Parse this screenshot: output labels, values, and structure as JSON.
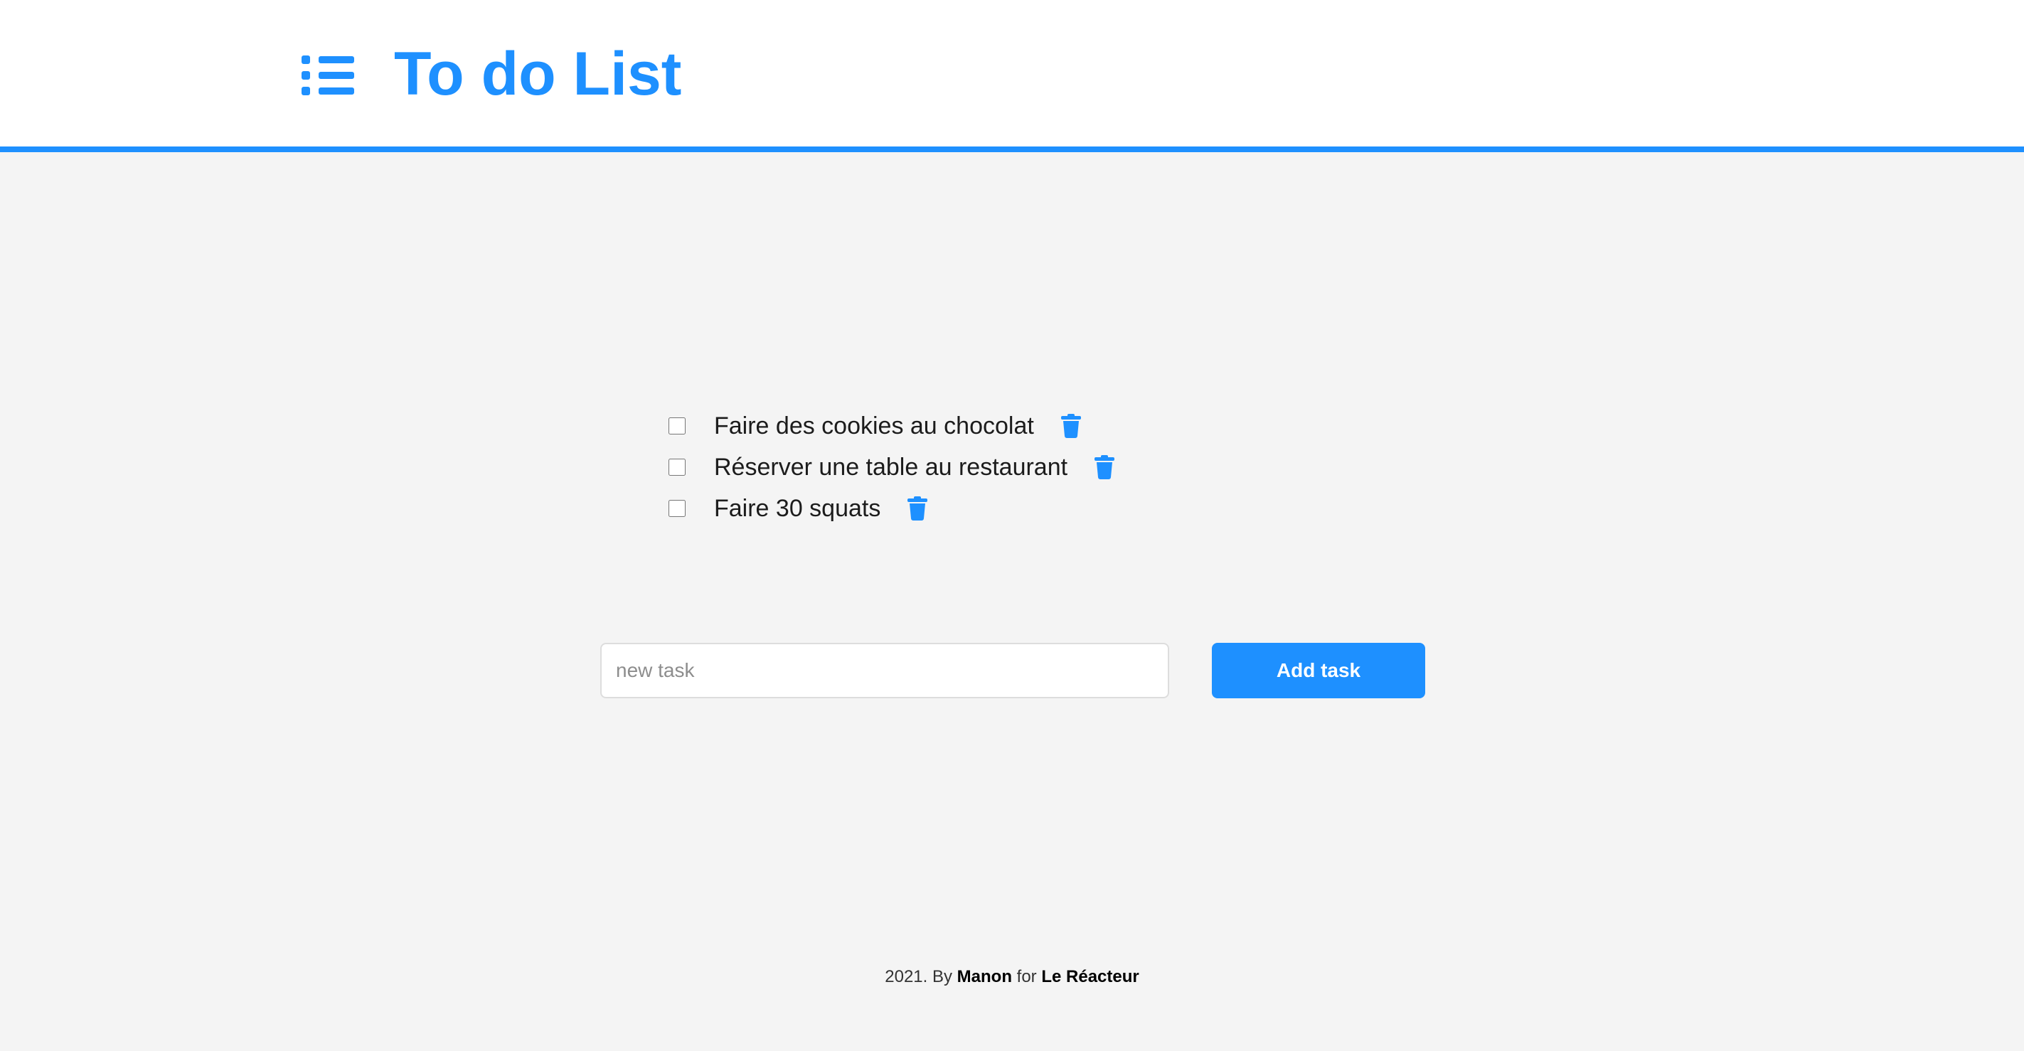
{
  "header": {
    "title": "To do List",
    "icon": "list-icon",
    "accent_color": "#1e90ff"
  },
  "tasks": [
    {
      "label": "Faire des cookies au chocolat",
      "checked": false,
      "delete_icon": "trash-icon"
    },
    {
      "label": "Réserver une table au restaurant",
      "checked": false,
      "delete_icon": "trash-icon"
    },
    {
      "label": "Faire 30 squats",
      "checked": false,
      "delete_icon": "trash-icon"
    }
  ],
  "form": {
    "input_placeholder": "new task",
    "input_value": "",
    "add_button_label": "Add task"
  },
  "footer": {
    "year_text": "2021. By",
    "author": "Manon",
    "for_text": "for",
    "organization": "Le Réacteur"
  }
}
